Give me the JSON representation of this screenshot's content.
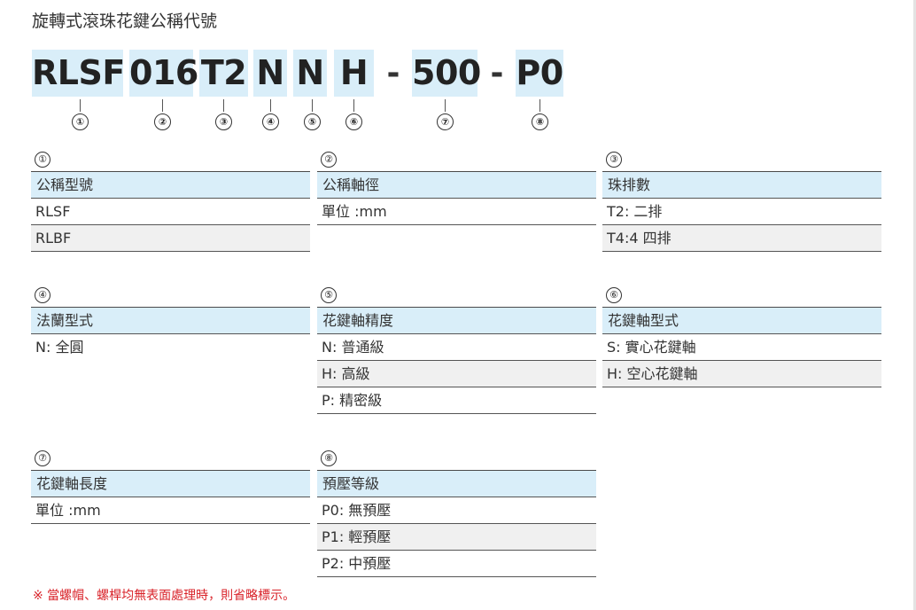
{
  "title": "旋轉式滾珠花鍵公稱代號",
  "code": {
    "segments": [
      "RLSF",
      "016",
      "T2",
      "N",
      "N",
      "H",
      "500",
      "P0"
    ],
    "separators": [
      "-",
      "-"
    ]
  },
  "markers": [
    "①",
    "②",
    "③",
    "④",
    "⑤",
    "⑥",
    "⑦",
    "⑧"
  ],
  "tables": [
    {
      "num": "①",
      "header": "公稱型號",
      "rows": [
        "RLSF",
        "RLBF"
      ]
    },
    {
      "num": "②",
      "header": "公稱軸徑",
      "rows": [
        "單位 :mm"
      ]
    },
    {
      "num": "③",
      "header": "珠排數",
      "rows": [
        "T2: 二排",
        "T4:4 四排"
      ]
    },
    {
      "num": "④",
      "header": "法蘭型式",
      "rows": [
        "N: 全圓"
      ]
    },
    {
      "num": "⑤",
      "header": "花鍵軸精度",
      "rows": [
        "N: 普通級",
        "H: 高級",
        "P: 精密級"
      ]
    },
    {
      "num": "⑥",
      "header": "花鍵軸型式",
      "rows": [
        "S: 實心花鍵軸",
        "H: 空心花鍵軸"
      ]
    },
    {
      "num": "⑦",
      "header": "花鍵軸長度",
      "rows": [
        "單位 :mm"
      ]
    },
    {
      "num": "⑧",
      "header": "預壓等級",
      "rows": [
        "P0: 無預壓",
        "P1: 輕預壓",
        "P2: 中預壓"
      ]
    }
  ],
  "footnote": "※ 當螺帽、螺桿均無表面處理時，則省略標示。",
  "colors": {
    "highlight": "#d9eef9",
    "alt_row": "#f0f0f0",
    "note": "#d9232a"
  }
}
